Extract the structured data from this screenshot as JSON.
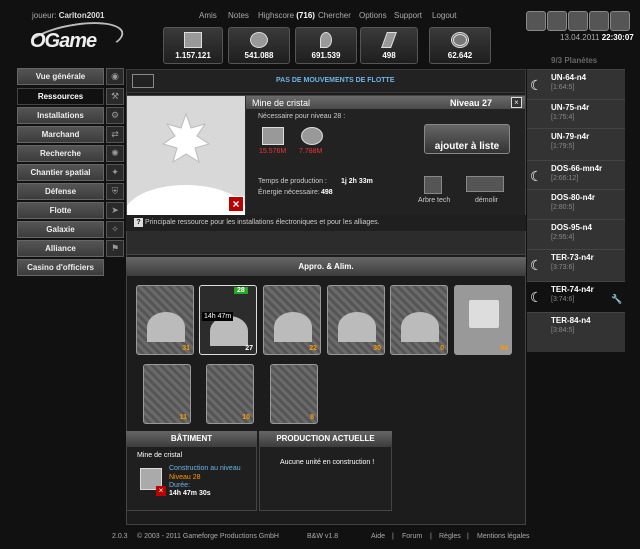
{
  "header": {
    "player_label": "joueur:",
    "player_name": "Carlton2001",
    "links": [
      "Amis",
      "Notes",
      "Highscore",
      "Chercher",
      "Options",
      "Support",
      "Logout"
    ],
    "highscore_rank": "(716)",
    "logo": "OGame"
  },
  "resources": [
    {
      "name": "metal-icon",
      "value": "1.157.121"
    },
    {
      "name": "crystal-icon",
      "value": "541.088"
    },
    {
      "name": "deuterium-icon",
      "value": "691.539"
    },
    {
      "name": "energy-icon",
      "value": "498"
    },
    {
      "name": "darkmatter-icon",
      "value": "62.642"
    }
  ],
  "datetime": {
    "date": "13.04.2011",
    "time": "22:30:07"
  },
  "sidebar": {
    "items": [
      {
        "label": "Vue générale"
      },
      {
        "label": "Ressources",
        "active": true
      },
      {
        "label": "Installations"
      },
      {
        "label": "Marchand"
      },
      {
        "label": "Recherche"
      },
      {
        "label": "Chantier spatial"
      },
      {
        "label": "Défense"
      },
      {
        "label": "Flotte"
      },
      {
        "label": "Galaxie"
      },
      {
        "label": "Alliance"
      },
      {
        "label": "Casino d'officiers"
      }
    ]
  },
  "fleet_status": "PAS DE MOUVEMENTS DE FLOTTE",
  "detail": {
    "title": "Mine de cristal",
    "level": "Niveau 27",
    "required_label": "Nécessaire pour niveau 28 :",
    "cost_metal": "15.576M",
    "cost_crystal": "7.788M",
    "production_time_label": "Temps de production :",
    "production_time": "1j 2h 33m",
    "energy_label": "Énergie nécessaire:",
    "energy": "498",
    "add_button": "ajouter à liste",
    "tech_tree": "Arbre tech",
    "demolish": "démolir",
    "help": "?",
    "description": "Principale ressource pour les installations électroniques et pour les alliages."
  },
  "section_title": "Appro. & Alim.",
  "buildings": [
    {
      "name": "metal-mine",
      "level": "31"
    },
    {
      "name": "crystal-mine",
      "level": "27",
      "queue": "28",
      "timer": "14h 47m"
    },
    {
      "name": "deuterium-synth",
      "level": "22"
    },
    {
      "name": "solar-plant",
      "level": "30"
    },
    {
      "name": "fusion-plant",
      "level": "0"
    },
    {
      "name": "solar-satellite",
      "level": "94"
    }
  ],
  "storages": [
    {
      "name": "metal-storage",
      "level": "11"
    },
    {
      "name": "crystal-storage",
      "level": "10"
    },
    {
      "name": "deuterium-storage",
      "level": "8"
    }
  ],
  "building_panel": {
    "title": "BÂTIMENT",
    "name": "Mine de cristal",
    "construction_label": "Construction au niveau",
    "level_line": "Niveau 28",
    "duration_label": "Durée:",
    "duration": "14h 47m 30s"
  },
  "production_panel": {
    "title": "PRODUCTION ACTUELLE",
    "empty_text": "Aucune unité en construction !"
  },
  "planets": {
    "count_label": "9/3 Planètes",
    "items": [
      {
        "name": "UN-64-n4",
        "coords": "[1:64:5]",
        "moon": true
      },
      {
        "name": "UN-75-n4r",
        "coords": "[1:75:4]",
        "moon": false
      },
      {
        "name": "UN-79-n4r",
        "coords": "[1:79:5]",
        "moon": false
      },
      {
        "name": "DOS-66-mn4r",
        "coords": "[2:66:12]",
        "moon": true
      },
      {
        "name": "DOS-80-n4r",
        "coords": "[2:80:5]",
        "moon": false
      },
      {
        "name": "DOS-95-n4",
        "coords": "[2:95:4]",
        "moon": false
      },
      {
        "name": "TER-73-n4r",
        "coords": "[3:73:6]",
        "moon": true
      },
      {
        "name": "TER-74-n4r",
        "coords": "[3:74:6]",
        "moon": true,
        "active": true
      },
      {
        "name": "TER-84-n4",
        "coords": "[3:84:5]",
        "moon": false
      }
    ]
  },
  "footer": {
    "version": "2.0.3",
    "copyright": "© 2003 - 2011 Gameforge Productions GmbH",
    "skin": "B&W v1.8",
    "links": [
      "Aide",
      "Forum",
      "Règles",
      "Mentions légales"
    ]
  },
  "colors": {
    "accent_blue": "#6cb6e8",
    "cost_red": "#e33",
    "level_orange": "#f90"
  }
}
